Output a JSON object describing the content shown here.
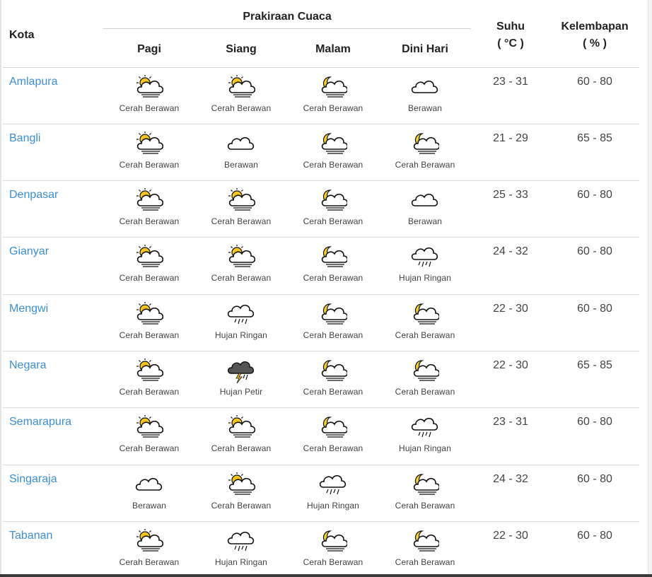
{
  "table": {
    "header": {
      "kota": "Kota",
      "forecast_group": "Prakiraan Cuaca",
      "periods": [
        "Pagi",
        "Siang",
        "Malam",
        "Dini Hari"
      ],
      "suhu": "Suhu",
      "suhu_unit": "( °C )",
      "kelembapan": "Kelembapan",
      "kelembapan_unit": "( % )"
    },
    "rows": [
      {
        "city": "Amlapura",
        "forecast": [
          {
            "label": "Cerah Berawan",
            "icon": "partly-sunny-icon"
          },
          {
            "label": "Cerah Berawan",
            "icon": "partly-sunny-icon"
          },
          {
            "label": "Cerah Berawan",
            "icon": "partly-cloudy-night-icon"
          },
          {
            "label": "Berawan",
            "icon": "cloud-icon"
          }
        ],
        "temp": "23 - 31",
        "humidity": "60 - 80"
      },
      {
        "city": "Bangli",
        "forecast": [
          {
            "label": "Cerah Berawan",
            "icon": "partly-sunny-icon"
          },
          {
            "label": "Berawan",
            "icon": "cloud-icon"
          },
          {
            "label": "Cerah Berawan",
            "icon": "partly-cloudy-night-icon"
          },
          {
            "label": "Cerah Berawan",
            "icon": "partly-cloudy-night-icon"
          }
        ],
        "temp": "21 - 29",
        "humidity": "65 - 85"
      },
      {
        "city": "Denpasar",
        "forecast": [
          {
            "label": "Cerah Berawan",
            "icon": "partly-sunny-icon"
          },
          {
            "label": "Cerah Berawan",
            "icon": "partly-sunny-icon"
          },
          {
            "label": "Cerah Berawan",
            "icon": "partly-cloudy-night-icon"
          },
          {
            "label": "Berawan",
            "icon": "cloud-icon"
          }
        ],
        "temp": "25 - 33",
        "humidity": "60 - 80"
      },
      {
        "city": "Gianyar",
        "forecast": [
          {
            "label": "Cerah Berawan",
            "icon": "partly-sunny-icon"
          },
          {
            "label": "Cerah Berawan",
            "icon": "partly-sunny-icon"
          },
          {
            "label": "Cerah Berawan",
            "icon": "partly-cloudy-night-icon"
          },
          {
            "label": "Hujan Ringan",
            "icon": "light-rain-icon"
          }
        ],
        "temp": "24 - 32",
        "humidity": "60 - 80"
      },
      {
        "city": "Mengwi",
        "forecast": [
          {
            "label": "Cerah Berawan",
            "icon": "partly-sunny-icon"
          },
          {
            "label": "Hujan Ringan",
            "icon": "light-rain-icon"
          },
          {
            "label": "Cerah Berawan",
            "icon": "partly-cloudy-night-icon"
          },
          {
            "label": "Cerah Berawan",
            "icon": "partly-cloudy-night-icon"
          }
        ],
        "temp": "22 - 30",
        "humidity": "60 - 80"
      },
      {
        "city": "Negara",
        "forecast": [
          {
            "label": "Cerah Berawan",
            "icon": "partly-sunny-icon"
          },
          {
            "label": "Hujan Petir",
            "icon": "thunderstorm-icon"
          },
          {
            "label": "Cerah Berawan",
            "icon": "partly-cloudy-night-icon"
          },
          {
            "label": "Cerah Berawan",
            "icon": "partly-cloudy-night-icon"
          }
        ],
        "temp": "22 - 30",
        "humidity": "65 - 85"
      },
      {
        "city": "Semarapura",
        "forecast": [
          {
            "label": "Cerah Berawan",
            "icon": "partly-sunny-icon"
          },
          {
            "label": "Cerah Berawan",
            "icon": "partly-sunny-icon"
          },
          {
            "label": "Cerah Berawan",
            "icon": "partly-cloudy-night-icon"
          },
          {
            "label": "Hujan Ringan",
            "icon": "light-rain-icon"
          }
        ],
        "temp": "23 - 31",
        "humidity": "60 - 80"
      },
      {
        "city": "Singaraja",
        "forecast": [
          {
            "label": "Berawan",
            "icon": "cloud-icon"
          },
          {
            "label": "Cerah Berawan",
            "icon": "partly-sunny-icon"
          },
          {
            "label": "Hujan Ringan",
            "icon": "light-rain-icon"
          },
          {
            "label": "Cerah Berawan",
            "icon": "partly-cloudy-night-icon"
          }
        ],
        "temp": "24 - 32",
        "humidity": "60 - 80"
      },
      {
        "city": "Tabanan",
        "forecast": [
          {
            "label": "Cerah Berawan",
            "icon": "partly-sunny-icon"
          },
          {
            "label": "Hujan Ringan",
            "icon": "light-rain-icon"
          },
          {
            "label": "Cerah Berawan",
            "icon": "partly-cloudy-night-icon"
          },
          {
            "label": "Cerah Berawan",
            "icon": "partly-cloudy-night-icon"
          }
        ],
        "temp": "22 - 30",
        "humidity": "60 - 80"
      }
    ]
  },
  "colors": {
    "link": "#3b8fd6",
    "sun": "#f5c518",
    "moon": "#f2d21a",
    "storm_cloud": "#555555"
  }
}
